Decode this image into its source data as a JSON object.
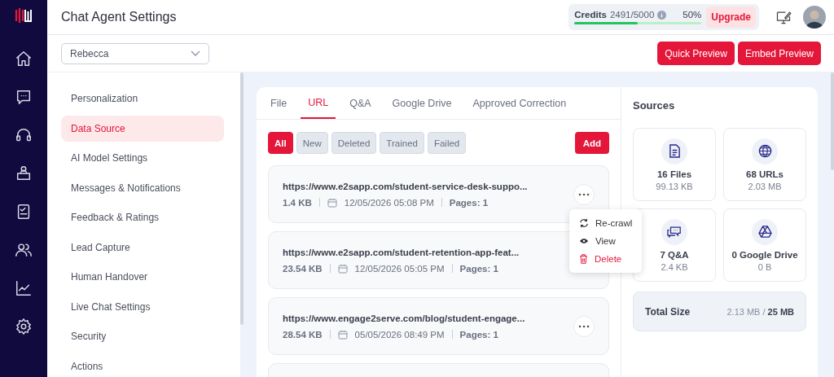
{
  "header": {
    "title": "Chat Agent Settings",
    "credits": {
      "label": "Credits",
      "value": "2491/5000",
      "percent": "50%",
      "level": 0.5
    },
    "upgrade": "Upgrade"
  },
  "agent_select": {
    "value": "Rebecca"
  },
  "actions": [
    "Quick Preview",
    "Embed Preview"
  ],
  "settings_menu": [
    {
      "label": "Personalization",
      "selected": false
    },
    {
      "label": "Data Source",
      "selected": true
    },
    {
      "label": "AI Model Settings",
      "selected": false
    },
    {
      "label": "Messages & Notifications",
      "selected": false
    },
    {
      "label": "Feedback & Ratings",
      "selected": false
    },
    {
      "label": "Lead Capture",
      "selected": false
    },
    {
      "label": "Human Handover",
      "selected": false
    },
    {
      "label": "Live Chat Settings",
      "selected": false
    },
    {
      "label": "Security",
      "selected": false
    },
    {
      "label": "Actions",
      "selected": false
    }
  ],
  "tabs": [
    {
      "label": "File",
      "selected": false
    },
    {
      "label": "URL",
      "selected": true
    },
    {
      "label": "Q&A",
      "selected": false
    },
    {
      "label": "Google Drive",
      "selected": false
    },
    {
      "label": "Approved Correction",
      "selected": false
    }
  ],
  "filters": [
    {
      "label": "All",
      "selected": true
    },
    {
      "label": "New",
      "selected": false
    },
    {
      "label": "Deleted",
      "selected": false
    },
    {
      "label": "Trained",
      "selected": false
    },
    {
      "label": "Failed",
      "selected": false
    }
  ],
  "add_button": "Add",
  "urls": [
    {
      "url": "https://www.e2sapp.com/student-service-desk-suppo...",
      "size": "1.4 KB",
      "date": "12/05/2026 05:08 PM",
      "pages": "Pages: 1"
    },
    {
      "url": "https://www.e2sapp.com/student-retention-app-feat...",
      "size": "23.54 KB",
      "date": "12/05/2026 05:05 PM",
      "pages": "Pages: 1"
    },
    {
      "url": "https://www.engage2serve.com/blog/student-engage...",
      "size": "28.54 KB",
      "date": "05/05/2026 08:49 PM",
      "pages": "Pages: 1"
    }
  ],
  "context_menu": [
    {
      "label": "Re-crawl",
      "kind": "recrawl"
    },
    {
      "label": "View",
      "kind": "view"
    },
    {
      "label": "Delete",
      "kind": "delete"
    }
  ],
  "sources": {
    "title": "Sources",
    "items": [
      {
        "kind": "file",
        "count": "16 Files",
        "size": "99.13 KB"
      },
      {
        "kind": "url",
        "count": "68 URLs",
        "size": "2.03 MB"
      },
      {
        "kind": "qa",
        "count": "7 Q&A",
        "size": "2.4 KB"
      },
      {
        "kind": "drive",
        "count": "0 Google Drive",
        "size": "0 B"
      }
    ],
    "total": {
      "label": "Total Size",
      "value": "2.13 MB / **25 MB**"
    }
  }
}
